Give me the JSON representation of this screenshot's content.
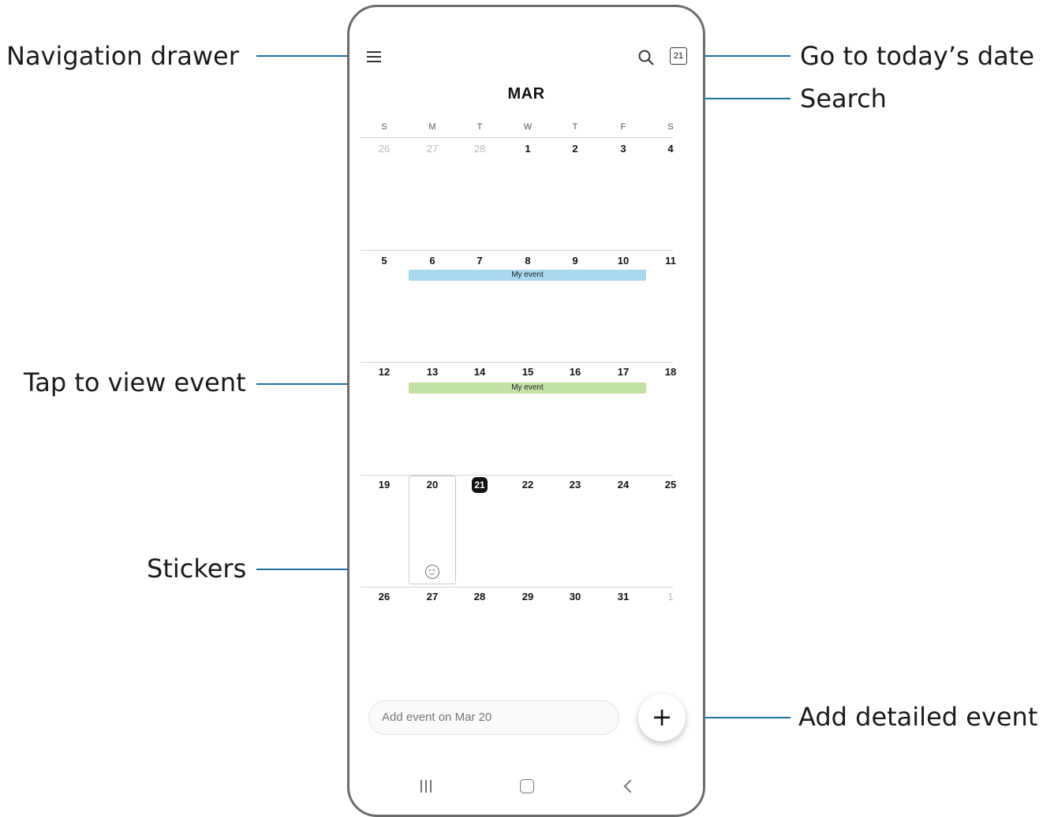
{
  "callouts": {
    "nav_drawer": "Navigation drawer",
    "today": "Go to today’s date",
    "search": "Search",
    "tap_event": "Tap to view event",
    "stickers": "Stickers",
    "add_detailed": "Add detailed event"
  },
  "calendar": {
    "month": "MAR",
    "today_btn": "21",
    "weekdays": [
      "S",
      "M",
      "T",
      "W",
      "T",
      "F",
      "S"
    ],
    "weeks": [
      [
        "26",
        "27",
        "28",
        "1",
        "2",
        "3",
        "4"
      ],
      [
        "5",
        "6",
        "7",
        "8",
        "9",
        "10",
        "11"
      ],
      [
        "12",
        "13",
        "14",
        "15",
        "16",
        "17",
        "18"
      ],
      [
        "19",
        "20",
        "21",
        "22",
        "23",
        "24",
        "25"
      ],
      [
        "26",
        "27",
        "28",
        "29",
        "30",
        "31",
        "1"
      ]
    ],
    "events": [
      {
        "label": "My event",
        "color": "#a8d8ee"
      },
      {
        "label": "My event",
        "color": "#c2dfa4"
      }
    ]
  },
  "add_event_placeholder": "Add event on Mar 20",
  "fab_symbol": "+",
  "colors": {
    "callout_line": "#1f6f9f",
    "today_bg": "#111111"
  }
}
